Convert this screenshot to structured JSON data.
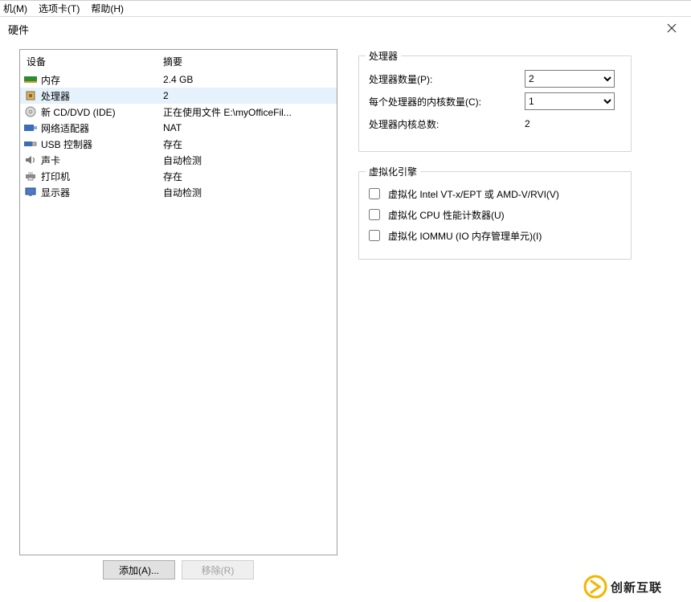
{
  "menubar": {
    "items": [
      "机(M)",
      "选项卡(T)",
      "帮助(H)"
    ]
  },
  "dialog": {
    "title": "硬件"
  },
  "hardware": {
    "head_device": "设备",
    "head_summary": "摘要",
    "rows": [
      {
        "icon": "memory-icon",
        "name": "内存",
        "summary": "2.4 GB"
      },
      {
        "icon": "cpu-icon",
        "name": "处理器",
        "summary": "2"
      },
      {
        "icon": "disc-icon",
        "name": "新 CD/DVD (IDE)",
        "summary": "正在使用文件 E:\\myOfficeFil..."
      },
      {
        "icon": "nic-icon",
        "name": "网络适配器",
        "summary": "NAT"
      },
      {
        "icon": "usb-icon",
        "name": "USB 控制器",
        "summary": "存在"
      },
      {
        "icon": "sound-icon",
        "name": "声卡",
        "summary": "自动检测"
      },
      {
        "icon": "printer-icon",
        "name": "打印机",
        "summary": "存在"
      },
      {
        "icon": "display-icon",
        "name": "显示器",
        "summary": "自动检测"
      }
    ],
    "selected_index": 1,
    "add_label": "添加(A)...",
    "remove_label": "移除(R)"
  },
  "proc_group": {
    "title": "处理器",
    "count_label": "处理器数量(P):",
    "count_value": "2",
    "cores_label": "每个处理器的内核数量(C):",
    "cores_value": "1",
    "total_label": "处理器内核总数:",
    "total_value": "2"
  },
  "virt_group": {
    "title": "虚拟化引擎",
    "opt1": "虚拟化 Intel VT-x/EPT 或 AMD-V/RVI(V)",
    "opt2": "虚拟化 CPU 性能计数器(U)",
    "opt3": "虚拟化 IOMMU (IO 内存管理单元)(I)"
  },
  "watermark": {
    "text": "创新互联"
  }
}
